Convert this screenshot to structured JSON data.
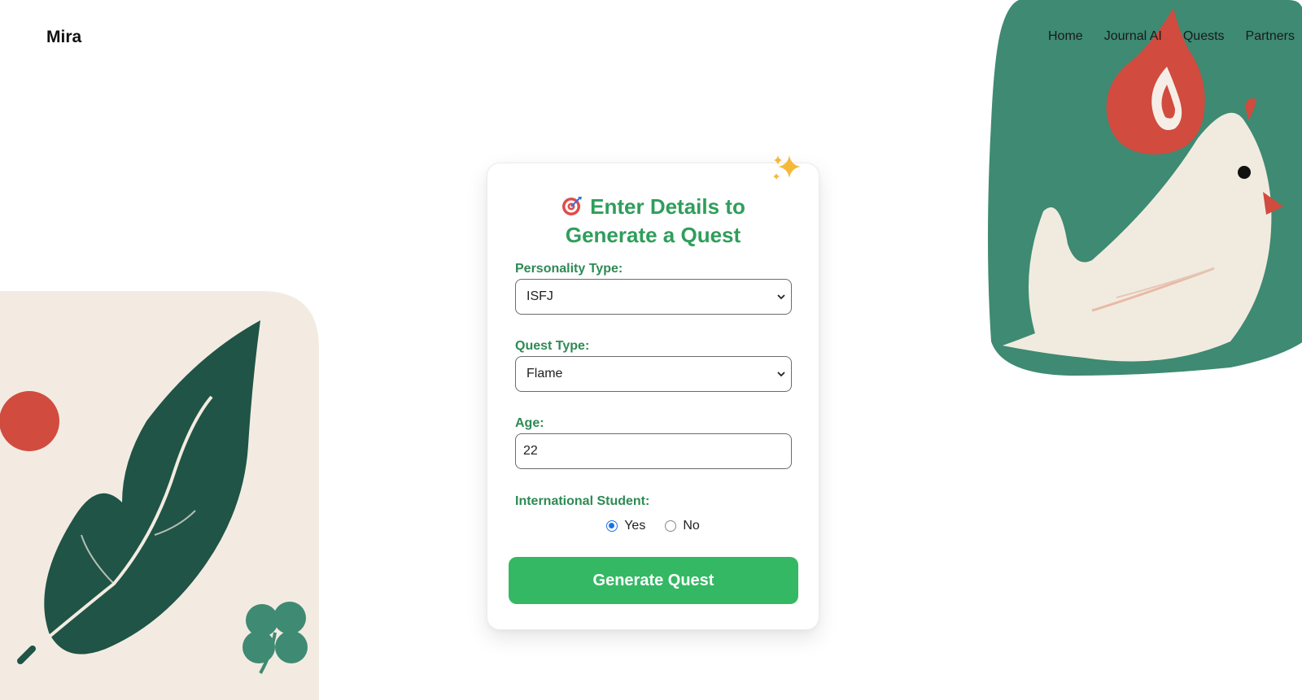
{
  "brand": "Mira",
  "nav": [
    "Home",
    "Journal AI",
    "Quests",
    "Partners"
  ],
  "form": {
    "title": "Enter Details to Generate a Quest",
    "title_icon": "target-icon",
    "personality": {
      "label": "Personality Type:",
      "value": "ISFJ"
    },
    "quest_type": {
      "label": "Quest Type:",
      "value": "Flame"
    },
    "age": {
      "label": "Age:",
      "value": "22"
    },
    "international": {
      "label": "International Student:",
      "options": [
        "Yes",
        "No"
      ],
      "selected": "Yes"
    },
    "submit": "Generate Quest"
  },
  "colors": {
    "accent_green": "#2f9e5b",
    "button_green": "#34b864",
    "teal": "#3e8a73",
    "dark_leaf": "#1f5446",
    "red": "#d14b3f",
    "cream": "#f3ebe1"
  }
}
